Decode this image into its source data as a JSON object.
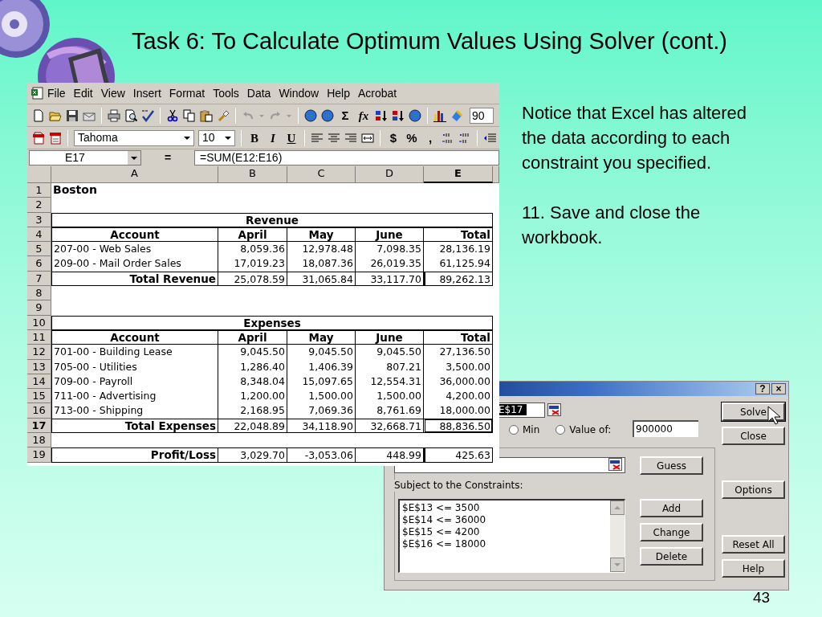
{
  "slide": {
    "title": "Task 6: To Calculate Optimum Values Using Solver (cont.)",
    "notes": [
      "Notice that Excel has altered the data according to each constraint you specified.",
      "11. Save and close the workbook."
    ],
    "page_number": "43"
  },
  "excel": {
    "menu": [
      {
        "label": "File"
      },
      {
        "label": "Edit"
      },
      {
        "label": "View"
      },
      {
        "label": "Insert"
      },
      {
        "label": "Format"
      },
      {
        "label": "Tools"
      },
      {
        "label": "Data"
      },
      {
        "label": "Window"
      },
      {
        "label": "Help"
      },
      {
        "label": "Acrobat"
      }
    ],
    "standard_toolbar": {
      "autosum": "Σ",
      "function": "fx",
      "zoom": "90"
    },
    "formatting_toolbar": {
      "font": "Tahoma",
      "size": "10",
      "bold": "B",
      "italic": "I",
      "underline": "U",
      "currency": "$",
      "percent": "%",
      "comma": ","
    },
    "formula_bar": {
      "name_box": "E17",
      "equals": "=",
      "formula": "=SUM(E12:E16)"
    },
    "sheet": {
      "columns": [
        {
          "label": "A",
          "selected": false
        },
        {
          "label": "B",
          "selected": false
        },
        {
          "label": "C",
          "selected": false
        },
        {
          "label": "D",
          "selected": false
        },
        {
          "label": "E",
          "selected": true
        }
      ],
      "rows": [
        {
          "number": "1",
          "selected": false,
          "kind": "title",
          "cells": [
            "Boston"
          ]
        },
        {
          "number": "2",
          "selected": false,
          "kind": "blank",
          "cells": []
        },
        {
          "number": "3",
          "selected": false,
          "kind": "section",
          "cells": [
            "Revenue"
          ]
        },
        {
          "number": "4",
          "selected": false,
          "kind": "header",
          "cells": [
            "Account",
            "April",
            "May",
            "June",
            "Total"
          ]
        },
        {
          "number": "5",
          "selected": false,
          "kind": "data",
          "cells": [
            "207-00 - Web Sales",
            "8,059.36",
            "12,978.48",
            "7,098.35",
            "28,136.19"
          ]
        },
        {
          "number": "6",
          "selected": false,
          "kind": "data",
          "cells": [
            "209-00 - Mail Order Sales",
            "17,019.23",
            "18,087.36",
            "26,019.35",
            "61,125.94"
          ]
        },
        {
          "number": "7",
          "selected": false,
          "kind": "total",
          "cells": [
            "Total Revenue",
            "25,078.59",
            "31,065.84",
            "33,117.70",
            "89,262.13"
          ]
        },
        {
          "number": "8",
          "selected": false,
          "kind": "blank",
          "cells": []
        },
        {
          "number": "9",
          "selected": false,
          "kind": "blank",
          "cells": []
        },
        {
          "number": "10",
          "selected": false,
          "kind": "section",
          "cells": [
            "Expenses"
          ]
        },
        {
          "number": "11",
          "selected": false,
          "kind": "header",
          "cells": [
            "Account",
            "April",
            "May",
            "June",
            "Total"
          ]
        },
        {
          "number": "12",
          "selected": false,
          "kind": "data",
          "cells": [
            "701-00 - Building Lease",
            "9,045.50",
            "9,045.50",
            "9,045.50",
            "27,136.50"
          ]
        },
        {
          "number": "13",
          "selected": false,
          "kind": "data",
          "cells": [
            "705-00 - Utilities",
            "1,286.40",
            "1,406.39",
            "807.21",
            "3,500.00"
          ]
        },
        {
          "number": "14",
          "selected": false,
          "kind": "data",
          "cells": [
            "709-00 - Payroll",
            "8,348.04",
            "15,097.65",
            "12,554.31",
            "36,000.00"
          ]
        },
        {
          "number": "15",
          "selected": false,
          "kind": "data",
          "cells": [
            "711-00 - Advertising",
            "1,200.00",
            "1,500.00",
            "1,500.00",
            "4,200.00"
          ]
        },
        {
          "number": "16",
          "selected": false,
          "kind": "data",
          "cells": [
            "713-00 - Shipping",
            "2,168.95",
            "7,069.36",
            "8,761.69",
            "18,000.00"
          ]
        },
        {
          "number": "17",
          "selected": true,
          "kind": "total",
          "cells": [
            "Total Expenses",
            "22,048.89",
            "34,118.90",
            "32,668.71",
            "88,836.50"
          ]
        },
        {
          "number": "18",
          "selected": false,
          "kind": "blank",
          "cells": []
        },
        {
          "number": "19",
          "selected": false,
          "kind": "total",
          "cells": [
            "Profit/Loss",
            "3,029.70",
            "-3,053.06",
            "448.99",
            "425.63"
          ]
        }
      ]
    }
  },
  "solver": {
    "title_buttons": [
      "?",
      "×"
    ],
    "target_cell": "E$17",
    "radios": [
      {
        "label": "Min",
        "selected": false
      },
      {
        "label": "Value of:",
        "selected": false
      }
    ],
    "value": "900000",
    "constraints_label": "Subject to the Constraints:",
    "constraints": [
      "$E$13 <= 3500",
      "$E$14 <= 36000",
      "$E$15 <= 4200",
      "$E$16 <= 18000"
    ],
    "buttons": [
      {
        "label": "Solve"
      },
      {
        "label": "Close"
      },
      {
        "label": "Guess"
      },
      {
        "label": "Options"
      },
      {
        "label": "Add"
      },
      {
        "label": "Change"
      },
      {
        "label": "Delete"
      },
      {
        "label": "Reset All"
      },
      {
        "label": "Help"
      }
    ]
  }
}
